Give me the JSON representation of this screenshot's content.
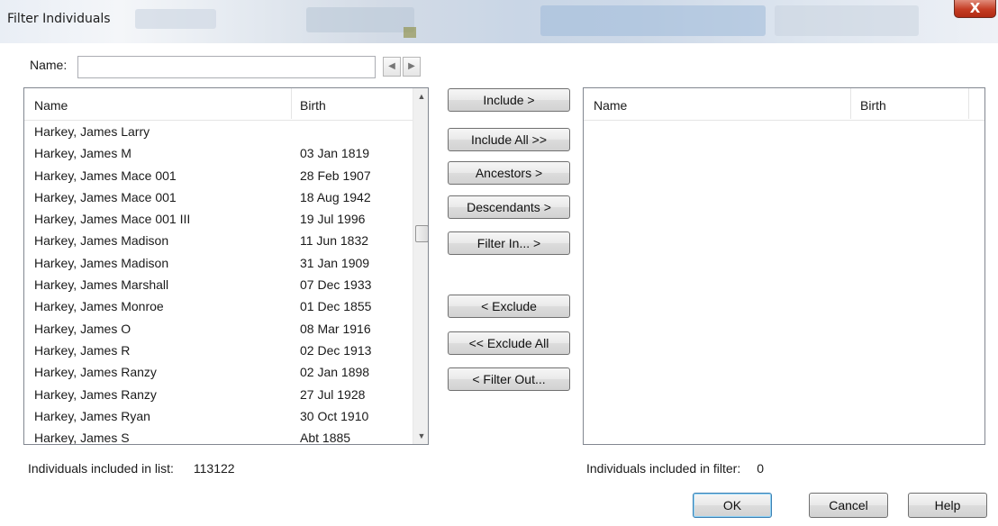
{
  "window": {
    "title": "Filter Individuals",
    "close_glyph": "X",
    "close_icon": "close-icon"
  },
  "name_search": {
    "label": "Name:",
    "value": "",
    "prev_icon": "arrow-left-icon",
    "next_icon": "arrow-right-icon"
  },
  "left_list": {
    "columns": [
      "Name",
      "Birth"
    ],
    "rows": [
      {
        "name": "Harkey, James Larry",
        "birth": ""
      },
      {
        "name": "Harkey, James M",
        "birth": "03 Jan 1819"
      },
      {
        "name": "Harkey, James Mace 001",
        "birth": "28 Feb 1907"
      },
      {
        "name": "Harkey, James Mace 001",
        "birth": "18 Aug 1942"
      },
      {
        "name": "Harkey, James Mace 001 III",
        "birth": "19 Jul 1996"
      },
      {
        "name": "Harkey, James Madison",
        "birth": "11 Jun 1832"
      },
      {
        "name": "Harkey, James Madison",
        "birth": "31 Jan 1909"
      },
      {
        "name": "Harkey, James Marshall",
        "birth": "07 Dec 1933"
      },
      {
        "name": "Harkey, James Monroe",
        "birth": "01 Dec 1855"
      },
      {
        "name": "Harkey, James O",
        "birth": "08 Mar 1916"
      },
      {
        "name": "Harkey, James R",
        "birth": "02 Dec 1913"
      },
      {
        "name": "Harkey, James Ranzy",
        "birth": "02 Jan 1898"
      },
      {
        "name": "Harkey, James Ranzy",
        "birth": "27 Jul 1928"
      },
      {
        "name": "Harkey, James Ryan",
        "birth": "30 Oct 1910"
      },
      {
        "name": "Harkey, James S",
        "birth": "Abt 1885"
      }
    ]
  },
  "right_list": {
    "columns": [
      "Name",
      "Birth"
    ],
    "rows": []
  },
  "actions": {
    "include": "Include >",
    "include_all": "Include All  >>",
    "ancestors": "Ancestors >",
    "descendants": "Descendants >",
    "filter_in": "Filter In... >",
    "exclude": "< Exclude",
    "exclude_all": "<< Exclude All",
    "filter_out": "< Filter Out..."
  },
  "status": {
    "list_label": "Individuals included in list:",
    "list_count": "113122",
    "filter_label": "Individuals included in filter:",
    "filter_count": "0"
  },
  "footer": {
    "ok": "OK",
    "cancel": "Cancel",
    "help": "Help"
  }
}
